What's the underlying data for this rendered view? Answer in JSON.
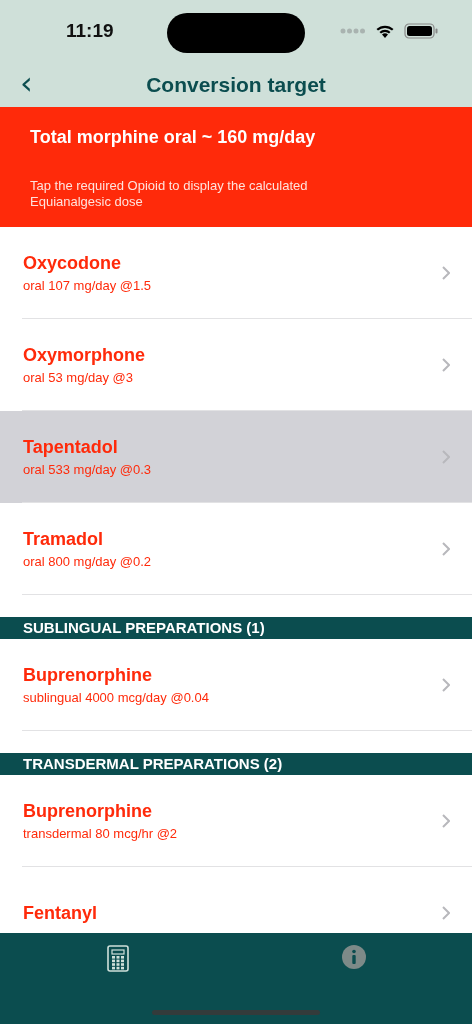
{
  "status_bar": {
    "time": "11:19"
  },
  "nav": {
    "back": "‹",
    "title": "Conversion target"
  },
  "banner": {
    "title": "Total morphine oral ~ 160 mg/day",
    "note": "Tap the required Opioid to display the calculated Equianalgesic dose"
  },
  "groups": [
    {
      "items": [
        {
          "name": "Oxycodone",
          "detail": "oral 107 mg/day @1.5",
          "selected": false
        },
        {
          "name": "Oxymorphone",
          "detail": "oral 53 mg/day @3",
          "selected": false
        },
        {
          "name": "Tapentadol",
          "detail": "oral 533 mg/day @0.3",
          "selected": true
        },
        {
          "name": "Tramadol",
          "detail": "oral 800 mg/day @0.2",
          "selected": false
        }
      ]
    },
    {
      "header": "SUBLINGUAL PREPARATIONS (1)",
      "items": [
        {
          "name": "Buprenorphine",
          "detail": "sublingual 4000 mcg/day @0.04",
          "selected": false
        }
      ]
    },
    {
      "header": "TRANSDERMAL PREPARATIONS (2)",
      "items": [
        {
          "name": "Buprenorphine",
          "detail": "transdermal 80 mcg/hr @2",
          "selected": false
        },
        {
          "name": "Fentanyl",
          "selected": false
        }
      ]
    }
  ],
  "tabs": [
    {
      "kind": "calculator",
      "selected": true
    },
    {
      "kind": "info",
      "selected": false
    }
  ]
}
